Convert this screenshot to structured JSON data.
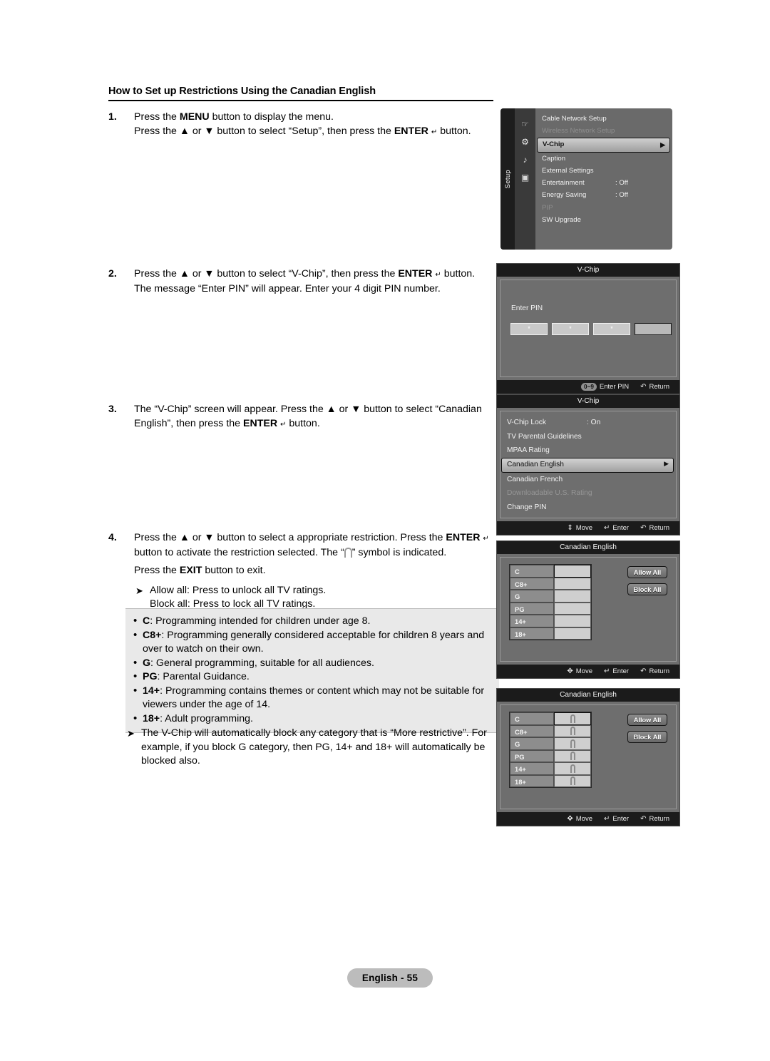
{
  "document": {
    "section_title": "How to Set up Restrictions Using the Canadian English",
    "footer": "English - 55"
  },
  "steps": [
    {
      "num": "1.",
      "lines": [
        "Press the MENU button to display the menu.",
        "Press the ▲ or ▼ button to select “Setup”, then press the ENTER ↵ button."
      ]
    },
    {
      "num": "2.",
      "lines": [
        "Press the ▲ or ▼ button to select “V-Chip”, then press the ENTER ↵ button.",
        "The message “Enter PIN” will appear. Enter your 4 digit PIN number."
      ]
    },
    {
      "num": "3.",
      "lines": [
        "The “V-Chip” screen will appear. Press the ▲ or ▼ button to select “Canadian English”, then press the ENTER ↵ button."
      ]
    },
    {
      "num": "4.",
      "lines": [
        "Press the ▲ or ▼ button to select a appropriate restriction. Press the ENTER ↵ button to activate the restriction selected. The “ □ ” symbol is indicated.",
        "Press the EXIT button to exit."
      ],
      "note": [
        "Allow all: Press to unlock all TV ratings.",
        "Block all: Press to lock all TV ratings."
      ]
    }
  ],
  "step4_text": {
    "p1_a": "Press the ",
    "p1_arrow_up": "▲",
    "p1_b": " or ",
    "p1_arrow_down": "▼",
    "p1_c": " button to select a appropriate restriction. Press the ",
    "p1_enter": "ENTER",
    "p1_d": " button to activate the restriction selected. The “",
    "p1_e": "” symbol is indicated.",
    "p2_a": "Press the ",
    "p2_exit": "EXIT",
    "p2_b": " button to exit.",
    "allow_all": "Allow all: Press to unlock all TV ratings.",
    "block_all": "Block all: Press to lock all TV ratings."
  },
  "rating_definitions": [
    {
      "code": "C",
      "text": ": Programming intended for children under age 8."
    },
    {
      "code": "C8+",
      "text": ": Programming generally considered acceptable for children 8 years and over to watch on their own."
    },
    {
      "code": "G",
      "text": ": General programming, suitable for all audiences."
    },
    {
      "code": "PG",
      "text": ": Parental Guidance."
    },
    {
      "code": "14+",
      "text": ": Programming contains themes or content which may not be suitable for viewers under the age of 14."
    },
    {
      "code": "18+",
      "text": ": Adult programming."
    }
  ],
  "more_restrictive_note": "The V-Chip will automatically block any category that is “More restrictive”. For example, if you block G category, then PG, 14+ and 18+ will automatically be blocked also.",
  "osd_setup": {
    "rail_label": "Setup",
    "icons": [
      "hand-pointer-icon",
      "gear-icon",
      "speaker-icon",
      "monitor-icon"
    ],
    "items": [
      {
        "label": "Cable Network Setup",
        "value": "",
        "state": "normal"
      },
      {
        "label": "Wireless Network Setup",
        "value": "",
        "state": "dim"
      },
      {
        "label": "V-Chip",
        "value": "",
        "state": "highlight"
      },
      {
        "label": "Caption",
        "value": "",
        "state": "normal"
      },
      {
        "label": "External Settings",
        "value": "",
        "state": "normal"
      },
      {
        "label": "Entertainment",
        "value": ": Off",
        "state": "normal"
      },
      {
        "label": "Energy Saving",
        "value": ": Off",
        "state": "normal"
      },
      {
        "label": "PIP",
        "value": "",
        "state": "dim"
      },
      {
        "label": "SW Upgrade",
        "value": "",
        "state": "normal"
      }
    ]
  },
  "osd_pin": {
    "title": "V-Chip",
    "label": "Enter PIN",
    "digits": [
      "*",
      "*",
      "*",
      ""
    ],
    "hints": [
      {
        "key": "0~9",
        "label": "Enter PIN",
        "icon": "number-keys-icon"
      },
      {
        "key": "",
        "label": "Return",
        "icon": "return-icon"
      }
    ]
  },
  "osd_vchip": {
    "title": "V-Chip",
    "items": [
      {
        "label": "V-Chip Lock",
        "value": ": On",
        "state": "normal"
      },
      {
        "label": "TV Parental Guidelines",
        "value": "",
        "state": "normal"
      },
      {
        "label": "MPAA Rating",
        "value": "",
        "state": "normal"
      },
      {
        "label": "Canadian English",
        "value": "",
        "state": "highlight"
      },
      {
        "label": "Canadian French",
        "value": "",
        "state": "normal"
      },
      {
        "label": "Downloadable U.S. Rating",
        "value": "",
        "state": "dim"
      },
      {
        "label": "Change PIN",
        "value": "",
        "state": "normal"
      }
    ],
    "hints": [
      {
        "key": "",
        "label": "Move",
        "icon": "updown-arrows-icon"
      },
      {
        "key": "",
        "label": "Enter",
        "icon": "enter-icon"
      },
      {
        "key": "",
        "label": "Return",
        "icon": "return-icon"
      }
    ]
  },
  "osd_canadian_english_unlocked": {
    "title": "Canadian English",
    "ratings": [
      {
        "code": "C",
        "locked": false,
        "selected": true
      },
      {
        "code": "C8+",
        "locked": false,
        "selected": false
      },
      {
        "code": "G",
        "locked": false,
        "selected": false
      },
      {
        "code": "PG",
        "locked": false,
        "selected": false
      },
      {
        "code": "14+",
        "locked": false,
        "selected": false
      },
      {
        "code": "18+",
        "locked": false,
        "selected": false
      }
    ],
    "allow_all": "Allow All",
    "block_all": "Block All",
    "hints": [
      {
        "key": "",
        "label": "Move",
        "icon": "four-way-arrows-icon"
      },
      {
        "key": "",
        "label": "Enter",
        "icon": "enter-icon"
      },
      {
        "key": "",
        "label": "Return",
        "icon": "return-icon"
      }
    ]
  },
  "osd_canadian_english_locked": {
    "title": "Canadian English",
    "ratings": [
      {
        "code": "C",
        "locked": true,
        "selected": true
      },
      {
        "code": "C8+",
        "locked": true,
        "selected": false
      },
      {
        "code": "G",
        "locked": true,
        "selected": false
      },
      {
        "code": "PG",
        "locked": true,
        "selected": false
      },
      {
        "code": "14+",
        "locked": true,
        "selected": false
      },
      {
        "code": "18+",
        "locked": true,
        "selected": false
      }
    ],
    "allow_all": "Allow All",
    "block_all": "Block All",
    "hints": [
      {
        "key": "",
        "label": "Move",
        "icon": "four-way-arrows-icon"
      },
      {
        "key": "",
        "label": "Enter",
        "icon": "enter-icon"
      },
      {
        "key": "",
        "label": "Return",
        "icon": "return-icon"
      }
    ]
  },
  "colors": {
    "osd_bg": "#6e6e6e",
    "osd_title_bg": "#1b1b1b",
    "highlight": "#cfcfcf",
    "info_box_bg": "#e9e9e9",
    "footer_pill_bg": "#bcbcbc"
  }
}
